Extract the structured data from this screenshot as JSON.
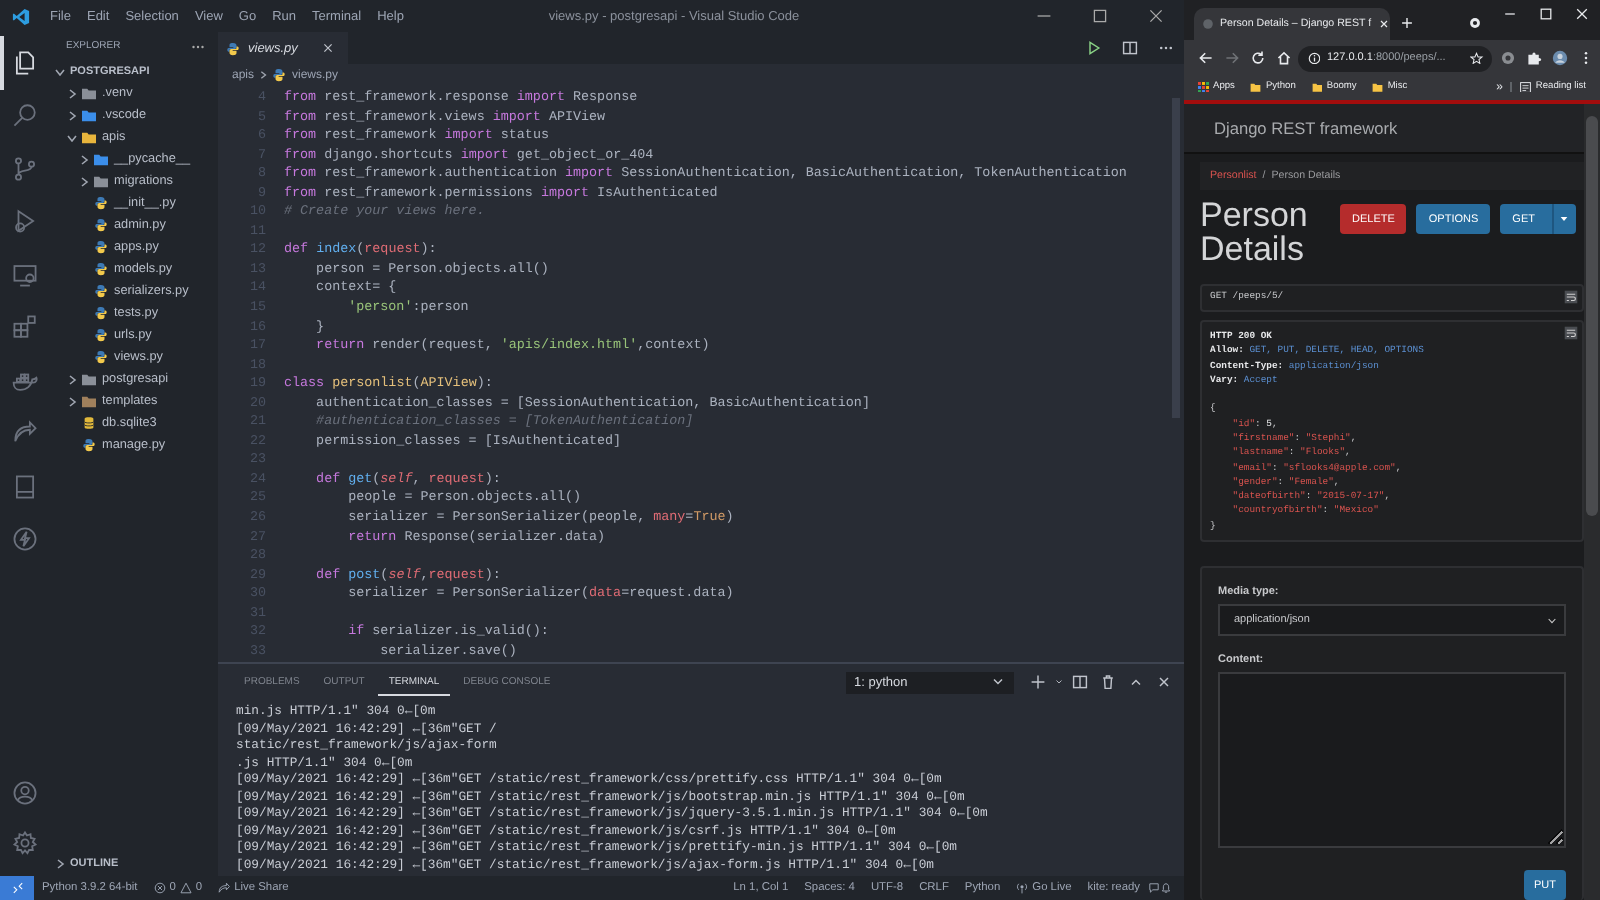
{
  "vscode": {
    "menu": [
      "File",
      "Edit",
      "Selection",
      "View",
      "Go",
      "Run",
      "Terminal",
      "Help"
    ],
    "title": "views.py - postgresapi - Visual Studio Code",
    "activity_bar": [
      {
        "kind": "explorer",
        "selected": true
      },
      {
        "kind": "search",
        "selected": false
      },
      {
        "kind": "source-control",
        "selected": false
      },
      {
        "kind": "run",
        "selected": false
      },
      {
        "kind": "remote",
        "selected": false
      },
      {
        "kind": "extensions",
        "selected": false
      },
      {
        "kind": "docker",
        "selected": false
      },
      {
        "kind": "live-share",
        "selected": false
      },
      {
        "kind": "book",
        "selected": false
      },
      {
        "kind": "bolt",
        "selected": false
      }
    ],
    "explorer": {
      "title": "EXPLORER",
      "root": {
        "label": "POSTGRESAPI",
        "expanded": true
      },
      "tree": [
        {
          "label": ".venv",
          "kind": "folder",
          "expanded": false,
          "color": "#8a8f98"
        },
        {
          "label": ".vscode",
          "kind": "folder",
          "expanded": false,
          "color": "#3b8eea"
        },
        {
          "label": "apis",
          "kind": "folder",
          "expanded": true,
          "color": "#e8b53c",
          "children": [
            {
              "label": "__pycache__",
              "kind": "folder",
              "expanded": false,
              "color": "#3b8eea"
            },
            {
              "label": "migrations",
              "kind": "folder",
              "expanded": false,
              "color": "#8a8f98"
            },
            {
              "label": "__init__.py",
              "kind": "python"
            },
            {
              "label": "admin.py",
              "kind": "python"
            },
            {
              "label": "apps.py",
              "kind": "python"
            },
            {
              "label": "models.py",
              "kind": "python"
            },
            {
              "label": "serializers.py",
              "kind": "python"
            },
            {
              "label": "tests.py",
              "kind": "python"
            },
            {
              "label": "urls.py",
              "kind": "python"
            },
            {
              "label": "views.py",
              "kind": "python"
            }
          ]
        },
        {
          "label": "postgresapi",
          "kind": "folder",
          "expanded": false,
          "color": "#8a8f98"
        },
        {
          "label": "templates",
          "kind": "folder",
          "expanded": false,
          "color": "#a0805c"
        },
        {
          "label": "db.sqlite3",
          "kind": "database"
        },
        {
          "label": "manage.py",
          "kind": "python"
        }
      ],
      "outline": {
        "label": "OUTLINE",
        "expanded": false
      }
    },
    "editor": {
      "tab": "views.py",
      "breadcrumb": [
        "apis",
        "views.py"
      ],
      "lines": [
        {
          "n": "4",
          "tokens": [
            {
              "kind": "keyword",
              "text": "from"
            },
            {
              "kind": "plain",
              "text": " rest_framework.response "
            },
            {
              "kind": "keyword",
              "text": "import"
            },
            {
              "kind": "plain",
              "text": " Response"
            }
          ]
        },
        {
          "n": "5",
          "tokens": [
            {
              "kind": "keyword",
              "text": "from"
            },
            {
              "kind": "plain",
              "text": " rest_framework.views "
            },
            {
              "kind": "keyword",
              "text": "import"
            },
            {
              "kind": "plain",
              "text": " APIView"
            }
          ]
        },
        {
          "n": "6",
          "tokens": [
            {
              "kind": "keyword",
              "text": "from"
            },
            {
              "kind": "plain",
              "text": " rest_framework "
            },
            {
              "kind": "keyword",
              "text": "import"
            },
            {
              "kind": "plain",
              "text": " status"
            }
          ]
        },
        {
          "n": "7",
          "tokens": [
            {
              "kind": "keyword",
              "text": "from"
            },
            {
              "kind": "plain",
              "text": " django.shortcuts "
            },
            {
              "kind": "keyword",
              "text": "import"
            },
            {
              "kind": "plain",
              "text": " get_object_or_404"
            }
          ]
        },
        {
          "n": "8",
          "tokens": [
            {
              "kind": "keyword",
              "text": "from"
            },
            {
              "kind": "plain",
              "text": " rest_framework.authentication "
            },
            {
              "kind": "keyword",
              "text": "import"
            },
            {
              "kind": "plain",
              "text": " SessionAuthentication, BasicAuthentication, TokenAuthentication"
            }
          ]
        },
        {
          "n": "9",
          "tokens": [
            {
              "kind": "keyword",
              "text": "from"
            },
            {
              "kind": "plain",
              "text": " rest_framework.permissions "
            },
            {
              "kind": "keyword",
              "text": "import"
            },
            {
              "kind": "plain",
              "text": " IsAuthenticated"
            }
          ]
        },
        {
          "n": "10",
          "tokens": [
            {
              "kind": "comment",
              "text": "# Create your views here."
            }
          ]
        },
        {
          "n": "11"
        },
        {
          "n": "12",
          "tokens": [
            {
              "kind": "keyword",
              "text": "def "
            },
            {
              "kind": "function",
              "text": "index"
            },
            {
              "kind": "plain",
              "text": "("
            },
            {
              "kind": "param",
              "text": "request"
            },
            {
              "kind": "plain",
              "text": "):"
            }
          ]
        },
        {
          "n": "13",
          "tokens": [
            {
              "kind": "plain",
              "text": "    person = Person.objects.all()"
            }
          ]
        },
        {
          "n": "14",
          "tokens": [
            {
              "kind": "plain",
              "text": "    context= {"
            }
          ]
        },
        {
          "n": "15",
          "tokens": [
            {
              "kind": "string",
              "text": "        'person'"
            },
            {
              "kind": "plain",
              "text": ":person"
            }
          ]
        },
        {
          "n": "16",
          "tokens": [
            {
              "kind": "plain",
              "text": "    }"
            }
          ]
        },
        {
          "n": "17",
          "tokens": [
            {
              "kind": "keyword",
              "text": "    return"
            },
            {
              "kind": "plain",
              "text": " render(request, "
            },
            {
              "kind": "string",
              "text": "'apis/index.html'"
            },
            {
              "kind": "plain",
              "text": ",context)"
            }
          ]
        },
        {
          "n": "18"
        },
        {
          "n": "19",
          "tokens": [
            {
              "kind": "keyword",
              "text": "class "
            },
            {
              "kind": "class",
              "text": "personlist"
            },
            {
              "kind": "plain",
              "text": "("
            },
            {
              "kind": "class",
              "text": "APIView"
            },
            {
              "kind": "plain",
              "text": "):"
            }
          ]
        },
        {
          "n": "20",
          "tokens": [
            {
              "kind": "plain",
              "text": "    authentication_classes = [SessionAuthentication, BasicAuthentication]"
            }
          ]
        },
        {
          "n": "21",
          "tokens": [
            {
              "kind": "comment",
              "text": "    #authentication_classes = [TokenAuthentication]"
            }
          ]
        },
        {
          "n": "22",
          "tokens": [
            {
              "kind": "plain",
              "text": "    permission_classes = [IsAuthenticated]"
            }
          ]
        },
        {
          "n": "23"
        },
        {
          "n": "24",
          "tokens": [
            {
              "kind": "keyword",
              "text": "    def "
            },
            {
              "kind": "function",
              "text": "get"
            },
            {
              "kind": "plain",
              "text": "("
            },
            {
              "kind": "self",
              "text": "self"
            },
            {
              "kind": "plain",
              "text": ", "
            },
            {
              "kind": "param",
              "text": "request"
            },
            {
              "kind": "plain",
              "text": "):"
            }
          ]
        },
        {
          "n": "25",
          "tokens": [
            {
              "kind": "plain",
              "text": "        people = Person.objects.all()"
            }
          ]
        },
        {
          "n": "26",
          "tokens": [
            {
              "kind": "plain",
              "text": "        serializer = PersonSerializer(people, "
            },
            {
              "kind": "param",
              "text": "many"
            },
            {
              "kind": "plain",
              "text": "="
            },
            {
              "kind": "constant",
              "text": "True"
            },
            {
              "kind": "plain",
              "text": ")"
            }
          ]
        },
        {
          "n": "27",
          "tokens": [
            {
              "kind": "keyword",
              "text": "        return"
            },
            {
              "kind": "plain",
              "text": " Response(serializer.data)"
            }
          ]
        },
        {
          "n": "28"
        },
        {
          "n": "29",
          "tokens": [
            {
              "kind": "keyword",
              "text": "    def "
            },
            {
              "kind": "function",
              "text": "post"
            },
            {
              "kind": "plain",
              "text": "("
            },
            {
              "kind": "self",
              "text": "self"
            },
            {
              "kind": "plain",
              "text": ","
            },
            {
              "kind": "param",
              "text": "request"
            },
            {
              "kind": "plain",
              "text": "):"
            }
          ]
        },
        {
          "n": "30",
          "tokens": [
            {
              "kind": "plain",
              "text": "        serializer = PersonSerializer("
            },
            {
              "kind": "param",
              "text": "data"
            },
            {
              "kind": "plain",
              "text": "=request.data)"
            }
          ]
        },
        {
          "n": "31"
        },
        {
          "n": "32",
          "tokens": [
            {
              "kind": "keyword",
              "text": "        if"
            },
            {
              "kind": "plain",
              "text": " serializer.is_valid():"
            }
          ]
        },
        {
          "n": "33",
          "tokens": [
            {
              "kind": "plain",
              "text": "            serializer.save()"
            }
          ]
        }
      ]
    },
    "panel": {
      "tabs": [
        {
          "label": "PROBLEMS",
          "selected": false
        },
        {
          "label": "OUTPUT",
          "selected": false
        },
        {
          "label": "TERMINAL",
          "selected": true
        },
        {
          "label": "DEBUG CONSOLE",
          "selected": false
        }
      ],
      "terminal_select": "1: python",
      "lines": [
        "min.js HTTP/1.1\" 304 0←[0m",
        "[09/May/2021 16:42:29] ←[36m\"GET /",
        "static/rest_framework/js/ajax-form",
        ".js HTTP/1.1\" 304 0←[0m",
        "[09/May/2021 16:42:29] ←[36m\"GET /static/rest_framework/css/prettify.css HTTP/1.1\" 304 0←[0m",
        "[09/May/2021 16:42:29] ←[36m\"GET /static/rest_framework/js/bootstrap.min.js HTTP/1.1\" 304 0←[0m",
        "[09/May/2021 16:42:29] ←[36m\"GET /static/rest_framework/js/jquery-3.5.1.min.js HTTP/1.1\" 304 0←[0m",
        "[09/May/2021 16:42:29] ←[36m\"GET /static/rest_framework/js/csrf.js HTTP/1.1\" 304 0←[0m",
        "[09/May/2021 16:42:29] ←[36m\"GET /static/rest_framework/js/prettify-min.js HTTP/1.1\" 304 0←[0m",
        "[09/May/2021 16:42:29] ←[36m\"GET /static/rest_framework/js/ajax-form.js HTTP/1.1\" 304 0←[0m"
      ]
    },
    "status_bar": {
      "interpreter": "Python 3.9.2 64-bit",
      "errors": "0",
      "warnings": "0",
      "live_share": "Live Share",
      "right": [
        "Ln 1, Col 1",
        "Spaces: 4",
        "UTF-8",
        "CRLF",
        "Python"
      ],
      "go_live": "Go Live",
      "kite": "kite: ready"
    }
  },
  "browser": {
    "tab": "Person Details – Django REST f",
    "address": {
      "host": "127.0.0.1",
      "path": ":8000/peeps/..."
    },
    "bookmarks": [
      {
        "label": "Apps",
        "kind": "apps"
      },
      {
        "label": "Python",
        "kind": "folder"
      },
      {
        "label": "Boomy",
        "kind": "folder"
      },
      {
        "label": "Misc",
        "kind": "folder"
      }
    ],
    "more": "»",
    "reading_list": "Reading list",
    "page": {
      "brand": "Django REST framework",
      "breadcrumb": {
        "items": [
          {
            "label": "Personlist",
            "selected": false
          },
          {
            "label": "Person Details",
            "selected": true
          }
        ],
        "separator": "/"
      },
      "title": "Person Details",
      "buttons": [
        {
          "label": "DELETE",
          "kind": "danger"
        },
        {
          "label": "OPTIONS",
          "kind": "primary"
        },
        {
          "label": "GET",
          "kind": "dropdown"
        }
      ],
      "request": "GET /peeps/5/",
      "response": {
        "head": [
          [
            {
              "kind": "bold",
              "text": "HTTP 200 OK"
            }
          ],
          [
            {
              "kind": "bold",
              "text": "Allow:"
            },
            {
              "kind": "header_value",
              "text": " GET, PUT, DELETE, HEAD, OPTIONS"
            }
          ],
          [
            {
              "kind": "bold",
              "text": "Content-Type:"
            },
            {
              "kind": "header_value",
              "text": " application/json"
            }
          ],
          [
            {
              "kind": "bold",
              "text": "Vary:"
            },
            {
              "kind": "header_value",
              "text": " Accept"
            }
          ]
        ],
        "body": [
          [
            {
              "kind": "plain",
              "text": "{"
            }
          ],
          [
            {
              "kind": "key",
              "text": "    \"id\""
            },
            {
              "kind": "plain",
              "text": ": "
            },
            {
              "kind": "number",
              "text": "5"
            },
            {
              "kind": "plain",
              "text": ","
            }
          ],
          [
            {
              "kind": "key",
              "text": "    \"firstname\""
            },
            {
              "kind": "plain",
              "text": ": "
            },
            {
              "kind": "string",
              "text": "\"Stephi\""
            },
            {
              "kind": "plain",
              "text": ","
            }
          ],
          [
            {
              "kind": "key",
              "text": "    \"lastname\""
            },
            {
              "kind": "plain",
              "text": ": "
            },
            {
              "kind": "string",
              "text": "\"Flooks\""
            },
            {
              "kind": "plain",
              "text": ","
            }
          ],
          [
            {
              "kind": "key",
              "text": "    \"email\""
            },
            {
              "kind": "plain",
              "text": ": "
            },
            {
              "kind": "string",
              "text": "\"sflooks4@apple.com\""
            },
            {
              "kind": "plain",
              "text": ","
            }
          ],
          [
            {
              "kind": "key",
              "text": "    \"gender\""
            },
            {
              "kind": "plain",
              "text": ": "
            },
            {
              "kind": "string",
              "text": "\"Female\""
            },
            {
              "kind": "plain",
              "text": ","
            }
          ],
          [
            {
              "kind": "key",
              "text": "    \"dateofbirth\""
            },
            {
              "kind": "plain",
              "text": ": "
            },
            {
              "kind": "string",
              "text": "\"2015-07-17\""
            },
            {
              "kind": "plain",
              "text": ","
            }
          ],
          [
            {
              "kind": "key",
              "text": "    \"countryofbirth\""
            },
            {
              "kind": "plain",
              "text": ": "
            },
            {
              "kind": "string",
              "text": "\"Mexico\""
            }
          ],
          [
            {
              "kind": "plain",
              "text": "}"
            }
          ]
        ]
      },
      "form": {
        "media_label": "Media type:",
        "media_value": "application/json",
        "content_label": "Content:",
        "submit": "PUT"
      }
    }
  }
}
